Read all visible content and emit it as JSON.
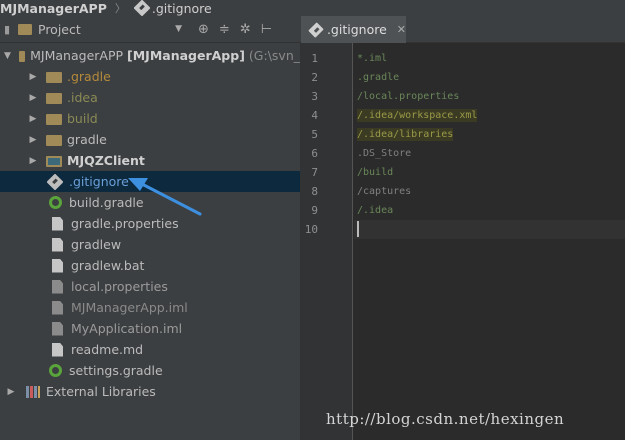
{
  "breadcrumb": {
    "project": "MJManagerAPP",
    "file": ".gitignore"
  },
  "panel": {
    "title": "Project",
    "root_name": "MJManagerAPP",
    "root_module": "[MJManagerApp]",
    "root_path": "(G:\\svn_"
  },
  "tree": [
    {
      "label": ".gradle",
      "type": "folder"
    },
    {
      "label": ".idea",
      "type": "folder"
    },
    {
      "label": "build",
      "type": "folder"
    },
    {
      "label": "gradle",
      "type": "folder"
    },
    {
      "label": "MJQZClient",
      "type": "module"
    },
    {
      "label": ".gitignore",
      "type": "git",
      "selected": true
    },
    {
      "label": "build.gradle",
      "type": "gradle"
    },
    {
      "label": "gradle.properties",
      "type": "file"
    },
    {
      "label": "gradlew",
      "type": "file"
    },
    {
      "label": "gradlew.bat",
      "type": "file"
    },
    {
      "label": "local.properties",
      "type": "file"
    },
    {
      "label": "MJManagerApp.iml",
      "type": "file"
    },
    {
      "label": "MyApplication.iml",
      "type": "file"
    },
    {
      "label": "readme.md",
      "type": "file"
    },
    {
      "label": "settings.gradle",
      "type": "gradle"
    },
    {
      "label": "External Libraries",
      "type": "libs"
    }
  ],
  "editor": {
    "tab_label": ".gitignore",
    "line_numbers": [
      "1",
      "2",
      "3",
      "4",
      "5",
      "6",
      "7",
      "8",
      "9",
      "10"
    ],
    "lines": [
      "*.iml",
      ".gradle",
      "/local.properties",
      "/.idea/workspace.xml",
      "/.idea/libraries",
      ".DS_Store",
      "/build",
      "/captures",
      "/.idea",
      ""
    ]
  },
  "watermark": "http://blog.csdn.net/hexingen",
  "colors": {
    "selection": "#0d293e",
    "annotation_arrow": "#3d8fe0",
    "tree_bg": "#3c3f41",
    "editor_bg": "#2b2b2b"
  }
}
